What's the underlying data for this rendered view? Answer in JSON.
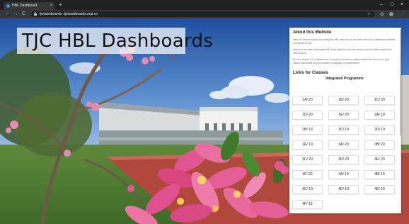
{
  "browser": {
    "tab_title": "HBL Dashboard",
    "tab_close": "×",
    "new_tab": "+",
    "url": "tjcdashboards--tjcdashboards.repl.co",
    "icons": [
      "back-icon",
      "forward-icon",
      "reload-icon",
      "lock-icon",
      "star-icon",
      "extension-icon",
      "profile-icon"
    ],
    "window_controls": {
      "minimize": "–",
      "maximize": "□",
      "close": "×"
    },
    "nav": {
      "back": "←",
      "forward": "→",
      "reload": "C"
    },
    "star": "☆"
  },
  "page": {
    "title": "TJC HBL Dashboards",
    "panel": {
      "about_heading": "About this Website",
      "paragraphs": [
        "Hello! To help everyone out during this HBL time period, we have rolled out a dashboard website for classes to use.",
        "Here you can view a timetable with a live indicator and can access common links required for HBL lessons.",
        "Do remind your CG Chairpersons to update your class's custom links! Feel free to use your class's dashboard as your browser homepage for convenience."
      ],
      "links_heading": "Links for Classes",
      "programme_heading": "Integrated Programme",
      "classes": [
        "1A/ 20",
        "1B/ 20",
        "1C/ 20",
        "1D/ 20",
        "1E/ 20",
        "2A/ 19",
        "2B/ 19",
        "2C/ 19",
        "2D/ 19",
        "2E/ 19",
        "3A/ 20",
        "3B/ 20",
        "3C/ 20",
        "3D/ 20",
        "3E/ 20",
        "3F/ 20",
        "4A/ 19",
        "4B/ 19",
        "4C/ 19",
        "4D/ 19",
        "4E/ 19",
        "4F/ 19"
      ]
    }
  },
  "colors": {
    "chrome_dark": "#202124",
    "chrome_toolbar": "#35363a",
    "sky": "#2a5fb0",
    "flower_pink": "#e2568f",
    "track_red": "#b0483c",
    "panel_bg": "#ffffff"
  }
}
